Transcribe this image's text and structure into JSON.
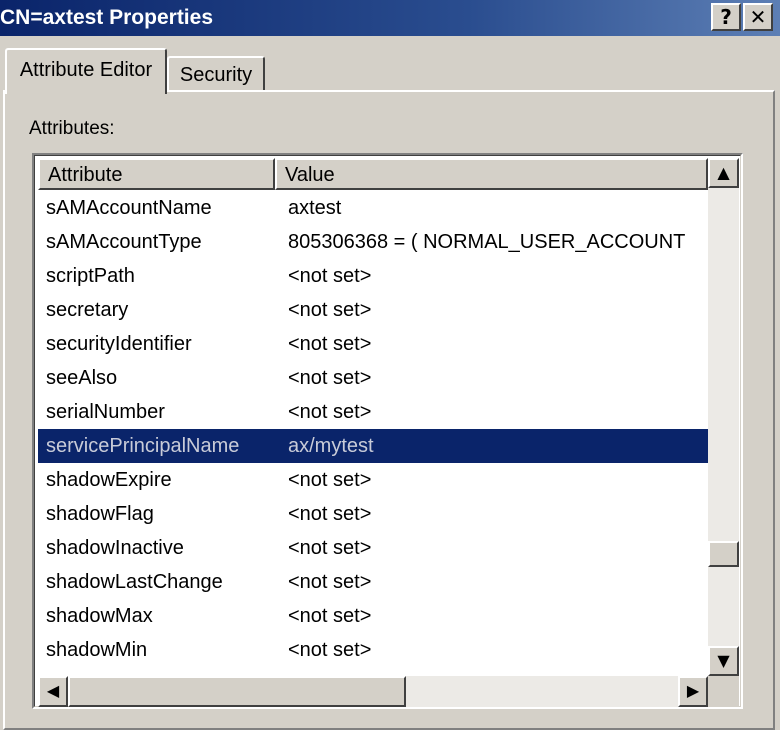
{
  "window": {
    "title": "CN=axtest Properties",
    "help_label": "?",
    "close_label": "✕"
  },
  "tabs": [
    {
      "label": "Attribute Editor",
      "active": true
    },
    {
      "label": "Security",
      "active": false
    }
  ],
  "attributes_label": "Attributes:",
  "table": {
    "columns": [
      "Attribute",
      "Value"
    ],
    "rows": [
      {
        "attribute": "sAMAccountName",
        "value": "axtest"
      },
      {
        "attribute": "sAMAccountType",
        "value": "805306368 = ( NORMAL_USER_ACCOUNT"
      },
      {
        "attribute": "scriptPath",
        "value": "<not set>"
      },
      {
        "attribute": "secretary",
        "value": "<not set>"
      },
      {
        "attribute": "securityIdentifier",
        "value": "<not set>"
      },
      {
        "attribute": "seeAlso",
        "value": "<not set>"
      },
      {
        "attribute": "serialNumber",
        "value": "<not set>"
      },
      {
        "attribute": "servicePrincipalName",
        "value": "ax/mytest",
        "selected": true
      },
      {
        "attribute": "shadowExpire",
        "value": "<not set>"
      },
      {
        "attribute": "shadowFlag",
        "value": "<not set>"
      },
      {
        "attribute": "shadowInactive",
        "value": "<not set>"
      },
      {
        "attribute": "shadowLastChange",
        "value": "<not set>"
      },
      {
        "attribute": "shadowMax",
        "value": "<not set>"
      },
      {
        "attribute": "shadowMin",
        "value": "<not set>"
      }
    ]
  },
  "scroll": {
    "up_icon": "▲",
    "down_icon": "▼",
    "left_icon": "◀",
    "right_icon": "▶"
  },
  "colors": {
    "title_bar": "#0a246a",
    "selection": "#0a246a",
    "face": "#d4d0c8"
  }
}
